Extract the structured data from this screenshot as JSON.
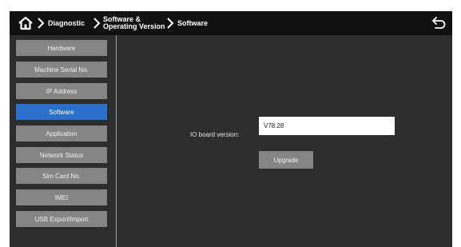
{
  "breadcrumb": {
    "home_icon": "home-icon",
    "items": [
      "Diagnostic",
      "Software &",
      "Operating Version",
      "Software"
    ],
    "separator_icon": "chevron-right-icon"
  },
  "topbar": {
    "back_icon": "back-arrow-icon"
  },
  "sidebar": {
    "items": [
      {
        "label": "Hardware"
      },
      {
        "label": "Machine Serial No."
      },
      {
        "label": "IP Address"
      },
      {
        "label": "Software"
      },
      {
        "label": "Application"
      },
      {
        "label": "Network Status"
      },
      {
        "label": "Sim Card No."
      },
      {
        "label": "IMEI"
      },
      {
        "label": "USB Export/Import"
      }
    ],
    "active_index": 3
  },
  "main": {
    "field_label": "IO board version:",
    "field_value": "V78.28",
    "upgrade_label": "Upgrade"
  },
  "colors": {
    "topbar_bg": "#111111",
    "panel_bg": "#2d2d2d",
    "button_bg": "#858585",
    "active_bg": "#2a6fc9"
  }
}
